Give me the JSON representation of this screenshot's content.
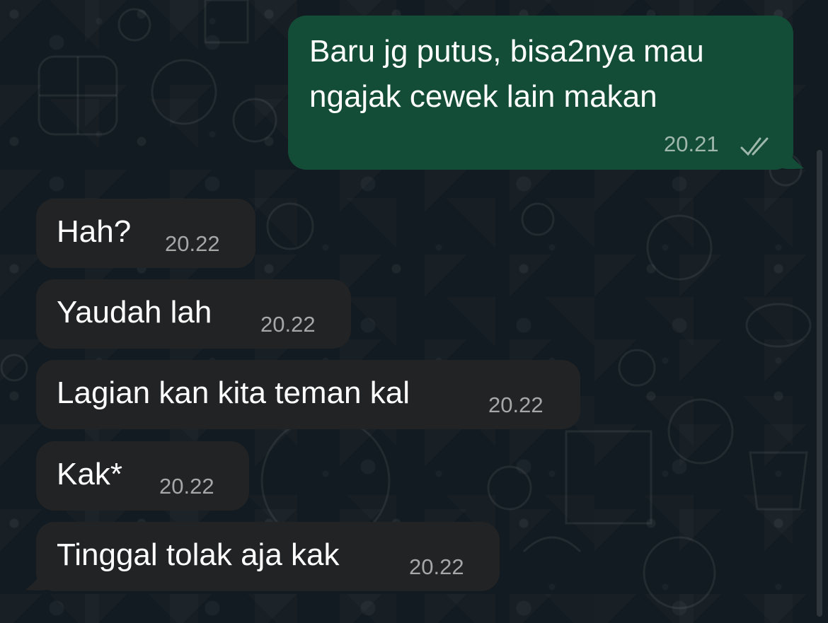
{
  "colors": {
    "background": "#121b21",
    "incoming_bubble": "#222324",
    "outgoing_bubble": "#144d37",
    "text": "#ffffff",
    "timestamp_incoming": "#a7a7a7",
    "timestamp_outgoing": "#9fb8ab"
  },
  "outgoing_message": {
    "line_1": "Baru jg putus, bisa2nya mau",
    "line_2": "ngajak cewek lain makan",
    "time": "20.21",
    "status_icon": "double-check-icon"
  },
  "incoming_messages": [
    {
      "text": "Hah?",
      "time": "20.22"
    },
    {
      "text": "Yaudah lah",
      "time": "20.22"
    },
    {
      "text": "Lagian kan kita teman kal",
      "time": "20.22"
    },
    {
      "text": "Kak*",
      "time": "20.22"
    },
    {
      "text": "Tinggal tolak aja kak",
      "time": "20.22"
    }
  ]
}
